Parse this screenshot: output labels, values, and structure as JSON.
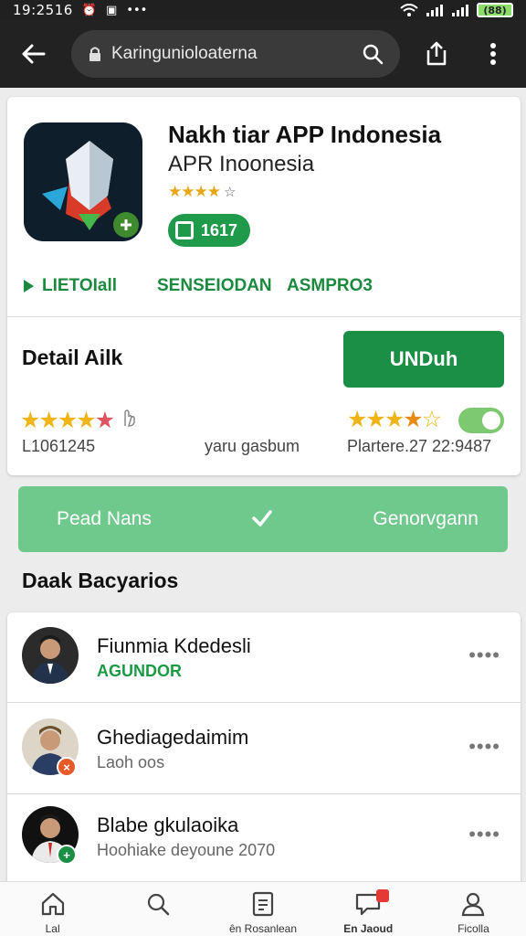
{
  "status_bar": {
    "time": "19:2516",
    "battery": "(88)"
  },
  "toolbar": {
    "url": "Karingunioloaterna"
  },
  "app": {
    "title": "Nakh tiar APP Indonesia",
    "subtitle": "APR Inoonesia",
    "rating_stars": "★★★★",
    "rating_tail": "☆",
    "badge": "1617",
    "tabs": [
      "LIETOIall",
      "SENSEIODAN",
      "ASMPRO3"
    ]
  },
  "detail": {
    "title": "Detail Ailk",
    "download_button": "UNDuh",
    "stat_left": "L1061245",
    "stat_mid": "yaru gasbum",
    "stat_right": "Plartere.27  22:9487"
  },
  "banner": {
    "left": "Pead Nans",
    "right": "Genorvgann"
  },
  "section": {
    "title": "Daak Bacyarios"
  },
  "list": [
    {
      "name": "Fiunmia Kdedesli",
      "sub": "AGUNDOR"
    },
    {
      "name": "Ghediagedaimim",
      "sub": "Laoh oos"
    },
    {
      "name": "Blabe gkulaoika",
      "sub": "Hoohiake deyoune 2070"
    }
  ],
  "bottom_nav": [
    "Lal",
    "",
    "ên Rosanlean",
    "En Jaoud",
    "Ficolla"
  ],
  "colors": {
    "accent_green": "#1a8f45",
    "banner_green": "#6fc98c",
    "toolbar": "#222222"
  }
}
